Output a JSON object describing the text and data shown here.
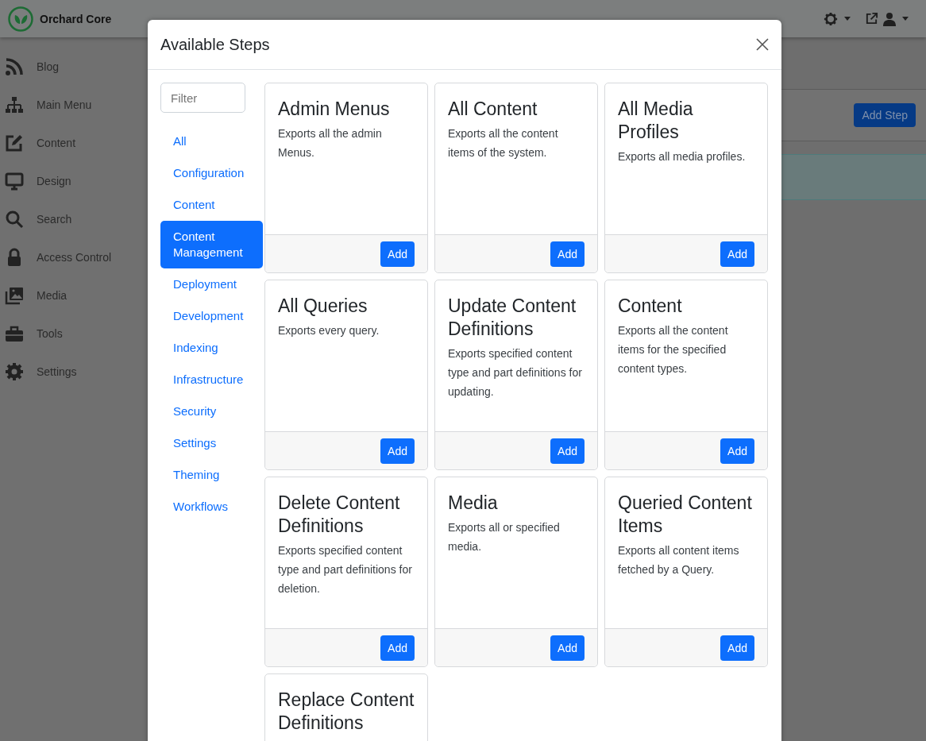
{
  "topbar": {
    "brand": "Orchard Core"
  },
  "sidebar": {
    "items": [
      {
        "label": "Blog"
      },
      {
        "label": "Main Menu"
      },
      {
        "label": "Content"
      },
      {
        "label": "Design"
      },
      {
        "label": "Search"
      },
      {
        "label": "Access Control"
      },
      {
        "label": "Media"
      },
      {
        "label": "Tools"
      },
      {
        "label": "Settings"
      }
    ]
  },
  "page": {
    "add_button": "Add Step"
  },
  "modal": {
    "title": "Available Steps",
    "filter": {
      "placeholder": "Filter"
    },
    "categories": [
      {
        "label": "All",
        "selected": false
      },
      {
        "label": "Configuration",
        "selected": false
      },
      {
        "label": "Content",
        "selected": false
      },
      {
        "label": "Content Management",
        "selected": true
      },
      {
        "label": "Deployment",
        "selected": false
      },
      {
        "label": "Development",
        "selected": false
      },
      {
        "label": "Indexing",
        "selected": false
      },
      {
        "label": "Infrastructure",
        "selected": false
      },
      {
        "label": "Security",
        "selected": false
      },
      {
        "label": "Settings",
        "selected": false
      },
      {
        "label": "Theming",
        "selected": false
      },
      {
        "label": "Workflows",
        "selected": false
      }
    ],
    "steps": [
      {
        "title": "Admin Menus",
        "description": "Exports all the admin Menus.",
        "button": "Add"
      },
      {
        "title": "All Content",
        "description": "Exports all the content items of the system.",
        "button": "Add"
      },
      {
        "title": "All Media Profiles",
        "description": "Exports all media profiles.",
        "button": "Add"
      },
      {
        "title": "All Queries",
        "description": "Exports every query.",
        "button": "Add"
      },
      {
        "title": "Update Content Definitions",
        "description": "Exports specified content type and part definitions for updating.",
        "button": "Add"
      },
      {
        "title": "Content",
        "description": "Exports all the content items for the specified content types.",
        "button": "Add"
      },
      {
        "title": "Delete Content Definitions",
        "description": "Exports specified content type and part definitions for deletion.",
        "button": "Add"
      },
      {
        "title": "Media",
        "description": "Exports all or specified media.",
        "button": "Add"
      },
      {
        "title": "Queried Content Items",
        "description": "Exports all content items fetched by a Query.",
        "button": "Add"
      },
      {
        "title": "Replace Content Definitions"
      }
    ]
  }
}
